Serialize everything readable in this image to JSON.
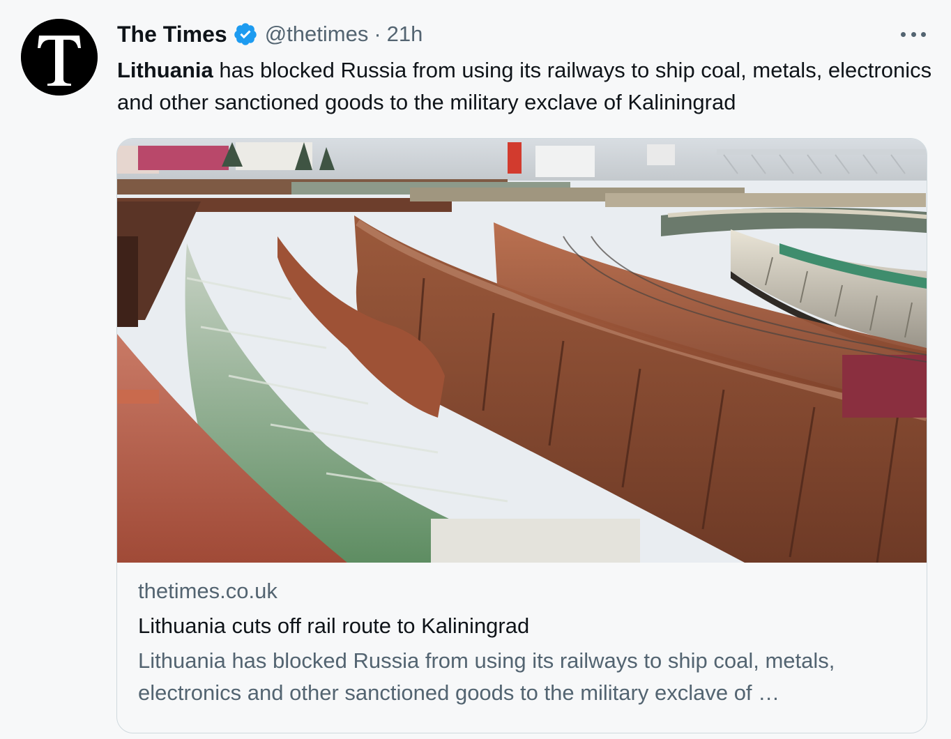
{
  "tweet": {
    "author_name": "The Times",
    "author_handle": "@thetimes",
    "separator": "·",
    "timestamp": "21h",
    "avatar_letter": "T",
    "text_bold": "Lithuania",
    "text_rest": " has blocked Russia from using its railways to ship coal, metals, electronics and other sanctioned goods to the military exclave of Kaliningrad"
  },
  "icons": {
    "verified": "verified-badge-icon",
    "more": "more-options-icon"
  },
  "colors": {
    "verified_blue": "#1d9bf0",
    "secondary_text": "#536471",
    "primary_text": "#0f1419",
    "background": "#f7f8f9"
  },
  "card": {
    "domain": "thetimes.co.uk",
    "title": "Lithuania cuts off rail route to Kaliningrad",
    "description": "Lithuania has blocked Russia from using its railways to ship coal, metals, electronics and other sanctioned goods to the military exclave of …"
  }
}
